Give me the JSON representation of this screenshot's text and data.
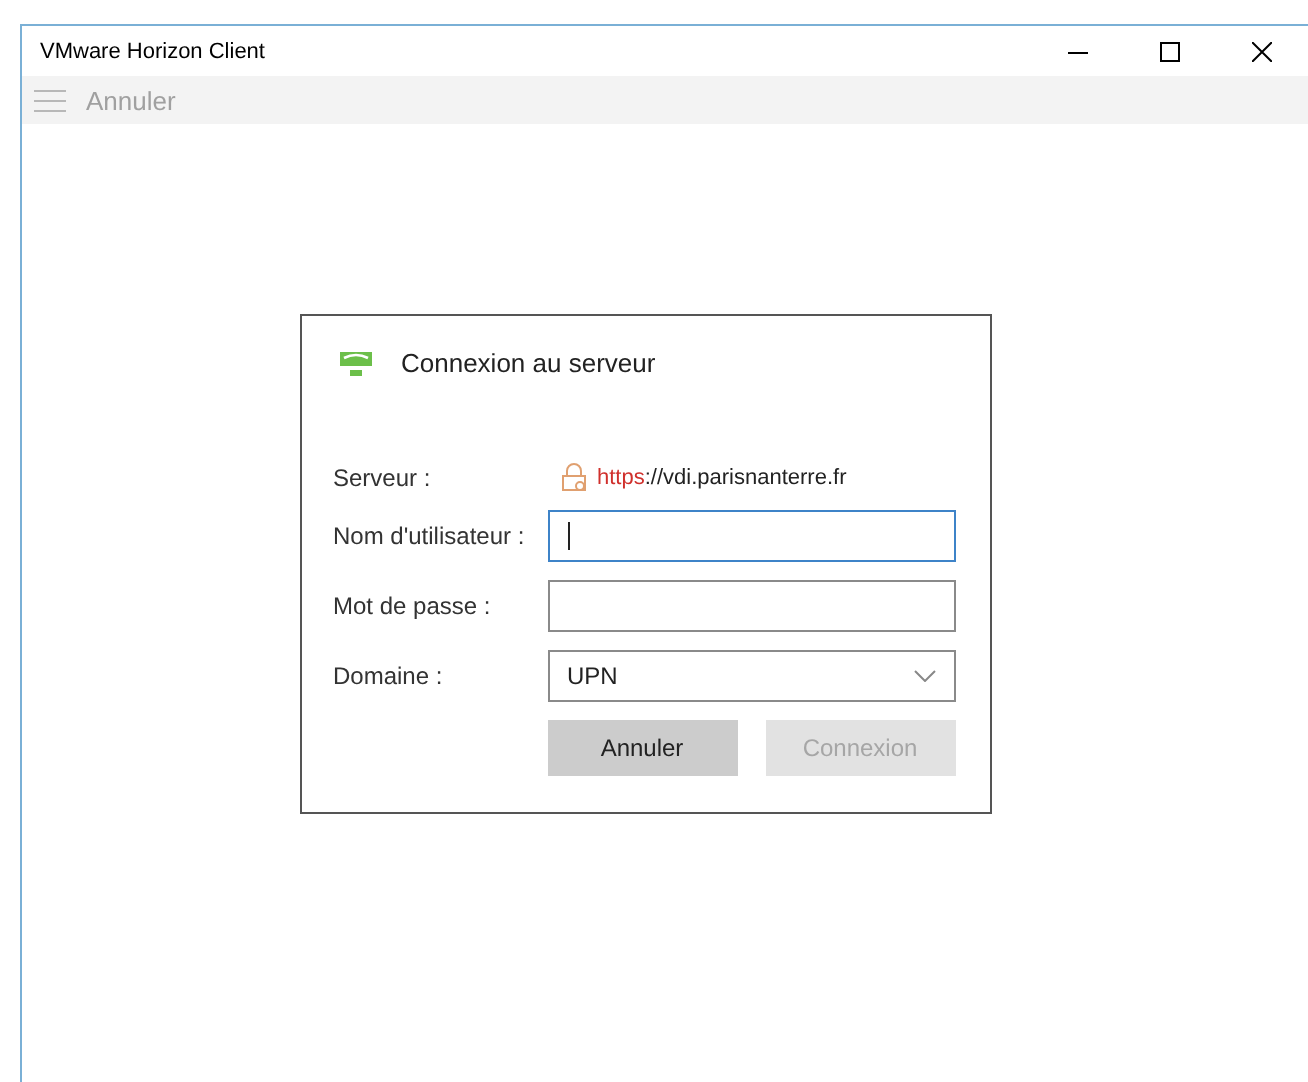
{
  "window": {
    "title": "VMware Horizon Client"
  },
  "toolbar": {
    "label": "Annuler",
    "disabled": true
  },
  "dialog": {
    "title": "Connexion au serveur",
    "server": {
      "label": "Serveur :",
      "scheme": "https",
      "rest": "://vdi.parisnanterre.fr"
    },
    "fields": [
      {
        "label": "Nom d'utilisateur :",
        "kind": "text",
        "focused": true
      },
      {
        "label": "Mot de passe :",
        "kind": "password",
        "focused": false
      },
      {
        "label": "Domaine :",
        "kind": "select",
        "value": "UPN",
        "focused": false
      }
    ],
    "buttons": [
      {
        "label": "Annuler",
        "disabled": false
      },
      {
        "label": "Connexion",
        "disabled": true
      }
    ]
  }
}
